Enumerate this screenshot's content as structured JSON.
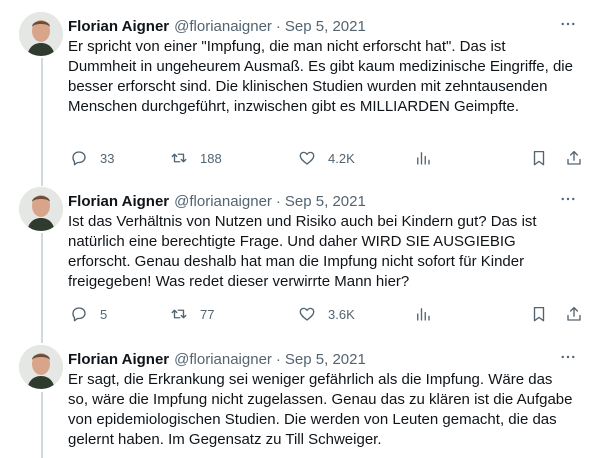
{
  "tweets": [
    {
      "author_name": "Florian Aigner",
      "handle": "@florianaigner",
      "separator": "·",
      "date": "Sep 5, 2021",
      "text": "Er spricht von einer \"Impfung, die man nicht erforscht hat\". Das ist Dummheit in ungeheurem Ausmaß. Es gibt kaum medizinische Eingriffe, die besser erforscht sind. Die klinischen Studien wurden mit zehntausenden Menschen durchgeführt, inzwischen gibt es MILLIARDEN Geimpfte.",
      "replies": "33",
      "retweets": "188",
      "likes": "4.2K"
    },
    {
      "author_name": "Florian Aigner",
      "handle": "@florianaigner",
      "separator": "·",
      "date": "Sep 5, 2021",
      "text": "Ist das Verhältnis von Nutzen und Risiko auch bei Kindern gut? Das ist natürlich eine berechtigte Frage. Und daher WIRD SIE AUSGIEBIG erforscht. Genau deshalb hat man die Impfung nicht sofort für Kinder freigegeben! Was redet dieser verwirrte Mann hier?",
      "replies": "5",
      "retweets": "77",
      "likes": "3.6K"
    },
    {
      "author_name": "Florian Aigner",
      "handle": "@florianaigner",
      "separator": "·",
      "date": "Sep 5, 2021",
      "text": "Er sagt, die Erkrankung sei weniger gefährlich als die Impfung. Wäre das so, wäre die Impfung nicht zugelassen. Genau das zu klären ist die Aufgabe von epidemiologischen Studien. Die werden von Leuten gemacht, die das gelernt haben. Im Gegensatz zu Till Schweiger."
    }
  ],
  "icons": {
    "more": "more-horizontal-icon",
    "reply": "reply-icon",
    "retweet": "retweet-icon",
    "like": "heart-icon",
    "views": "analytics-icon",
    "bookmark": "bookmark-icon",
    "share": "share-icon"
  },
  "colors": {
    "text": "#0f1419",
    "secondary": "#536471",
    "thread_line": "#cfd9de"
  }
}
